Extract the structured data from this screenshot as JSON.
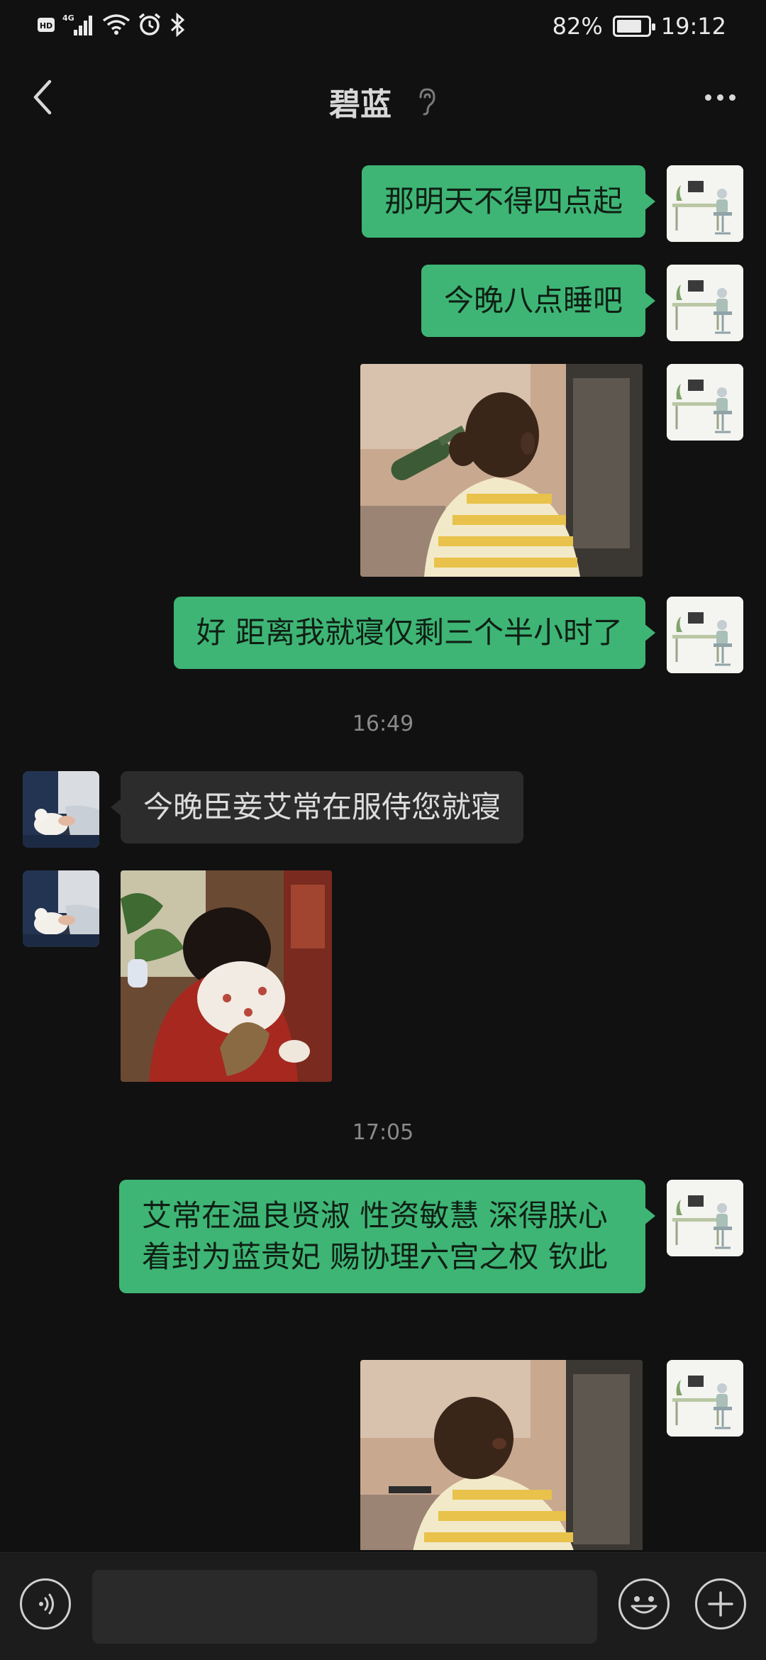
{
  "status_bar": {
    "network": "4G",
    "hd_badge": "HD",
    "battery_percent": "82%",
    "battery_level": 0.82,
    "time": "19:12",
    "icons": [
      "hd-icon",
      "signal-icon",
      "wifi-icon",
      "alarm-icon",
      "bluetooth-icon",
      "battery-icon"
    ]
  },
  "header": {
    "title": "碧蓝",
    "icons": [
      "back-icon",
      "earpiece-icon",
      "more-icon"
    ]
  },
  "messages": {
    "m1": {
      "sender": "me",
      "text": "那明天不得四点起"
    },
    "m2": {
      "sender": "me",
      "text": "今晚八点睡吧"
    },
    "m3": {
      "sender": "me",
      "type": "image",
      "image": "sticker-drinking-boy"
    },
    "m4": {
      "sender": "me",
      "text": "好 距离我就寝仅剩三个半小时了"
    },
    "t1": {
      "type": "time",
      "text": "16:49"
    },
    "m5": {
      "sender": "other",
      "text": "今晚臣妾艾常在服侍您就寝"
    },
    "m6": {
      "sender": "other",
      "type": "image",
      "image": "sticker-woman-hugging"
    },
    "t2": {
      "type": "time",
      "text": "17:05"
    },
    "m7": {
      "sender": "me",
      "text": "艾常在温良贤淑 性资敏慧 深得朕心 着封为蓝贵妃 赐协理六宫之权 钦此"
    },
    "m8": {
      "sender": "me",
      "type": "image",
      "image": "sticker-boy-pouting"
    }
  },
  "input_bar": {
    "value": "",
    "icons": [
      "voice-icon",
      "emoji-icon",
      "plus-icon"
    ]
  },
  "colors": {
    "background": "#111111",
    "my_bubble": "#3eb575",
    "other_bubble": "#2c2c2c",
    "timestamp": "#8a8a8a"
  }
}
